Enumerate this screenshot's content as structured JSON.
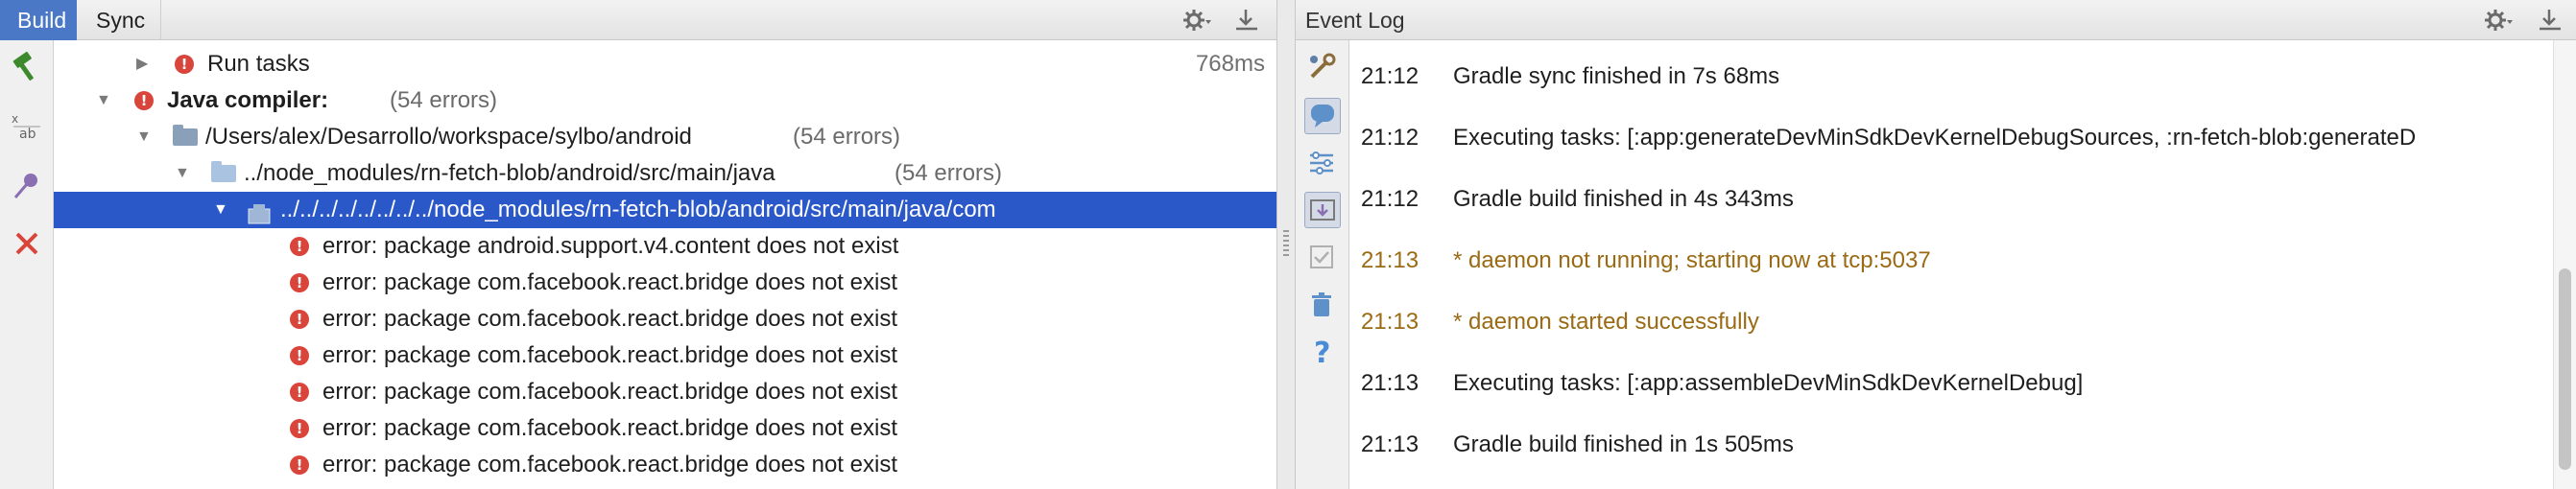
{
  "build_panel": {
    "tabs": [
      {
        "label": "Build",
        "active": true
      },
      {
        "label": "Sync",
        "active": false
      }
    ],
    "tree": [
      {
        "label": "Run tasks",
        "time": "768ms",
        "icon": "error-icon",
        "expanded": false
      },
      {
        "label": "Java compiler:",
        "count": "(54 errors)",
        "icon": "error-icon",
        "expanded": true
      },
      {
        "label": "/Users/alex/Desarrollo/workspace/sylbo/android",
        "count": "(54 errors)",
        "icon": "module-folder-icon",
        "expanded": true
      },
      {
        "label": "../node_modules/rn-fetch-blob/android/src/main/java",
        "count": "(54 errors)",
        "icon": "source-folder-icon",
        "expanded": true
      },
      {
        "label": "../../../../../../../../node_modules/rn-fetch-blob/android/src/main/java/com",
        "icon": "package-icon",
        "expanded": true,
        "selected": true
      }
    ],
    "errors": [
      "error: package android.support.v4.content does not exist",
      "error: package com.facebook.react.bridge does not exist",
      "error: package com.facebook.react.bridge does not exist",
      "error: package com.facebook.react.bridge does not exist",
      "error: package com.facebook.react.bridge does not exist",
      "error: package com.facebook.react.bridge does not exist",
      "error: package com.facebook.react.bridge does not exist"
    ]
  },
  "event_log": {
    "title": "Event Log",
    "entries": [
      {
        "time": "21:12",
        "message": "Gradle sync finished in 7s 68ms",
        "level": "info"
      },
      {
        "time": "21:12",
        "message": "Executing tasks: [:app:generateDevMinSdkDevKernelDebugSources, :rn-fetch-blob:generateD",
        "level": "info"
      },
      {
        "time": "21:12",
        "message": "Gradle build finished in 4s 343ms",
        "level": "info"
      },
      {
        "time": "21:13",
        "message": "* daemon not running; starting now at tcp:5037",
        "level": "warning"
      },
      {
        "time": "21:13",
        "message": "* daemon started successfully",
        "level": "warning"
      },
      {
        "time": "21:13",
        "message": "Executing tasks: [:app:assembleDevMinSdkDevKernelDebug]",
        "level": "info"
      },
      {
        "time": "21:13",
        "message": "Gradle build finished in 1s 505ms",
        "level": "info"
      }
    ]
  },
  "colors": {
    "selection": "#2a58c8",
    "active_tab": "#4a78c7",
    "error": "#d9443b",
    "warning_text": "#9a6a14"
  }
}
